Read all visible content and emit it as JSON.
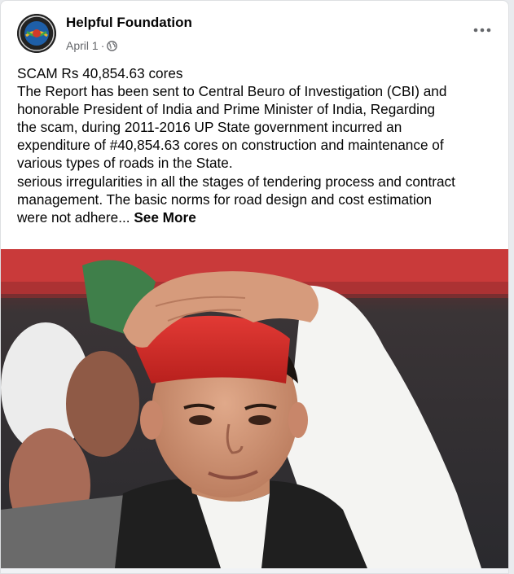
{
  "post": {
    "page_name": "Helpful Foundation",
    "date": "April 1",
    "separator": "·",
    "privacy_icon": "globe-icon",
    "more_icon": "ellipsis-icon",
    "text_lines": [
      "SCAM  Rs 40,854.63 cores",
      "The Report has been sent to Central Beuro of Investigation (CBI) and",
      "honorable President of India and Prime Minister of India, Regarding",
      "the scam, during 2011-2016 UP State government incurred an",
      "expenditure of #40,854.63 cores on construction and maintenance of",
      "various types of roads in the State.",
      "serious irregularities in all the stages of tendering process and contract",
      "management. The basic norms for road design and cost estimation",
      "were not adhere..."
    ],
    "see_more": "See More"
  },
  "colors": {
    "name_text": "#050505",
    "meta_text": "#65676b",
    "cap_red": "#d42a2a",
    "kurta_white": "#f4f4f2",
    "waistcoat_dark": "#1f1f1f"
  }
}
